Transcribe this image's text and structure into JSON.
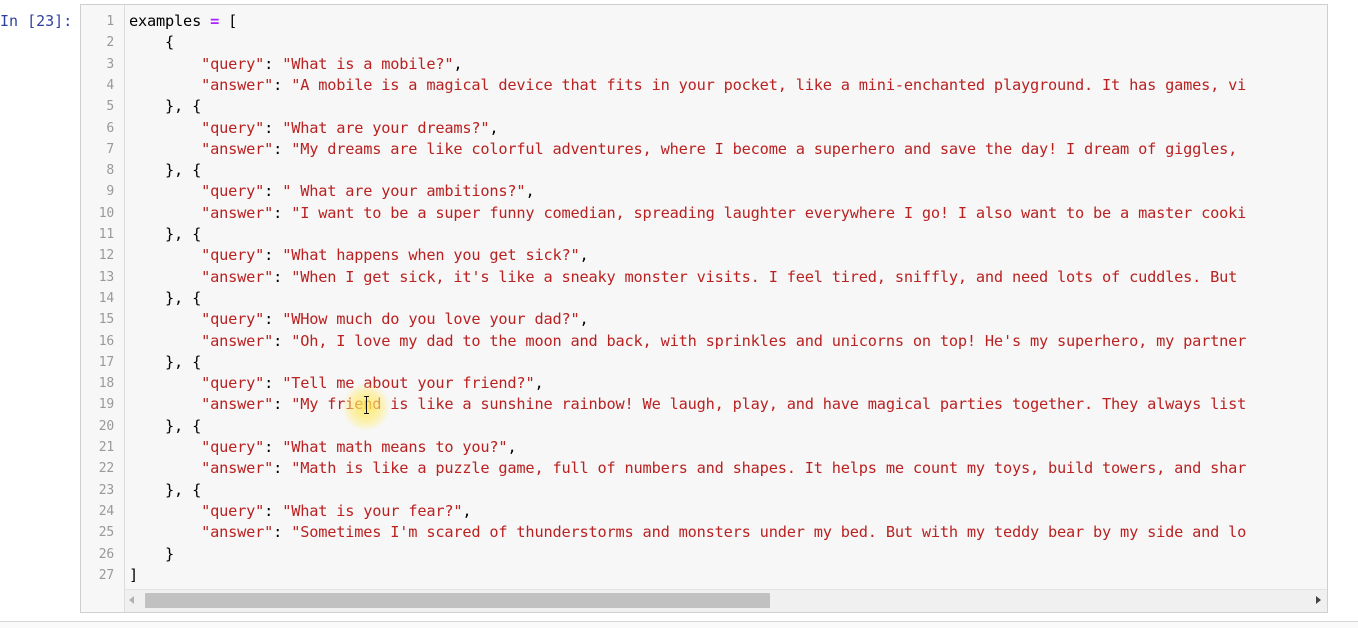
{
  "cell": {
    "prompt": "In [23]:",
    "lines": [
      {
        "num": "1",
        "tokens": [
          {
            "t": "var",
            "v": "examples "
          },
          {
            "t": "op",
            "v": "="
          },
          {
            "t": "punct",
            "v": " ["
          }
        ]
      },
      {
        "num": "2",
        "tokens": [
          {
            "t": "punct",
            "v": "    {"
          }
        ]
      },
      {
        "num": "3",
        "tokens": [
          {
            "t": "punct",
            "v": "        "
          },
          {
            "t": "key",
            "v": "\"query\""
          },
          {
            "t": "punct",
            "v": ": "
          },
          {
            "t": "val",
            "v": "\"What is a mobile?\""
          },
          {
            "t": "punct",
            "v": ","
          }
        ]
      },
      {
        "num": "4",
        "tokens": [
          {
            "t": "punct",
            "v": "        "
          },
          {
            "t": "key",
            "v": "\"answer\""
          },
          {
            "t": "punct",
            "v": ": "
          },
          {
            "t": "val",
            "v": "\"A mobile is a magical device that fits in your pocket, like a mini-enchanted playground. It has games, vi"
          }
        ]
      },
      {
        "num": "5",
        "tokens": [
          {
            "t": "punct",
            "v": "    }, {"
          }
        ]
      },
      {
        "num": "6",
        "tokens": [
          {
            "t": "punct",
            "v": "        "
          },
          {
            "t": "key",
            "v": "\"query\""
          },
          {
            "t": "punct",
            "v": ": "
          },
          {
            "t": "val",
            "v": "\"What are your dreams?\""
          },
          {
            "t": "punct",
            "v": ","
          }
        ]
      },
      {
        "num": "7",
        "tokens": [
          {
            "t": "punct",
            "v": "        "
          },
          {
            "t": "key",
            "v": "\"answer\""
          },
          {
            "t": "punct",
            "v": ": "
          },
          {
            "t": "val",
            "v": "\"My dreams are like colorful adventures, where I become a superhero and save the day! I dream of giggles, "
          }
        ]
      },
      {
        "num": "8",
        "tokens": [
          {
            "t": "punct",
            "v": "    }, {"
          }
        ]
      },
      {
        "num": "9",
        "tokens": [
          {
            "t": "punct",
            "v": "        "
          },
          {
            "t": "key",
            "v": "\"query\""
          },
          {
            "t": "punct",
            "v": ": "
          },
          {
            "t": "val",
            "v": "\" What are your ambitions?\""
          },
          {
            "t": "punct",
            "v": ","
          }
        ]
      },
      {
        "num": "10",
        "tokens": [
          {
            "t": "punct",
            "v": "        "
          },
          {
            "t": "key",
            "v": "\"answer\""
          },
          {
            "t": "punct",
            "v": ": "
          },
          {
            "t": "val",
            "v": "\"I want to be a super funny comedian, spreading laughter everywhere I go! I also want to be a master cooki"
          }
        ]
      },
      {
        "num": "11",
        "tokens": [
          {
            "t": "punct",
            "v": "    }, {"
          }
        ]
      },
      {
        "num": "12",
        "tokens": [
          {
            "t": "punct",
            "v": "        "
          },
          {
            "t": "key",
            "v": "\"query\""
          },
          {
            "t": "punct",
            "v": ": "
          },
          {
            "t": "val",
            "v": "\"What happens when you get sick?\""
          },
          {
            "t": "punct",
            "v": ","
          }
        ]
      },
      {
        "num": "13",
        "tokens": [
          {
            "t": "punct",
            "v": "        "
          },
          {
            "t": "key",
            "v": "\"answer\""
          },
          {
            "t": "punct",
            "v": ": "
          },
          {
            "t": "val",
            "v": "\"When I get sick, it's like a sneaky monster visits. I feel tired, sniffly, and need lots of cuddles. But "
          }
        ]
      },
      {
        "num": "14",
        "tokens": [
          {
            "t": "punct",
            "v": "    }, {"
          }
        ]
      },
      {
        "num": "15",
        "tokens": [
          {
            "t": "punct",
            "v": "        "
          },
          {
            "t": "key",
            "v": "\"query\""
          },
          {
            "t": "punct",
            "v": ": "
          },
          {
            "t": "val",
            "v": "\"WHow much do you love your dad?\""
          },
          {
            "t": "punct",
            "v": ","
          }
        ]
      },
      {
        "num": "16",
        "tokens": [
          {
            "t": "punct",
            "v": "        "
          },
          {
            "t": "key",
            "v": "\"answer\""
          },
          {
            "t": "punct",
            "v": ": "
          },
          {
            "t": "val",
            "v": "\"Oh, I love my dad to the moon and back, with sprinkles and unicorns on top! He's my superhero, my partner"
          }
        ]
      },
      {
        "num": "17",
        "tokens": [
          {
            "t": "punct",
            "v": "    }, {"
          }
        ]
      },
      {
        "num": "18",
        "tokens": [
          {
            "t": "punct",
            "v": "        "
          },
          {
            "t": "key",
            "v": "\"query\""
          },
          {
            "t": "punct",
            "v": ": "
          },
          {
            "t": "val",
            "v": "\"Tell me about your friend?\""
          },
          {
            "t": "punct",
            "v": ","
          }
        ]
      },
      {
        "num": "19",
        "tokens": [
          {
            "t": "punct",
            "v": "        "
          },
          {
            "t": "key",
            "v": "\"answer\""
          },
          {
            "t": "punct",
            "v": ": "
          },
          {
            "t": "val",
            "v": "\"My friend is like a sunshine rainbow! We laugh, play, and have magical parties together. They always list"
          }
        ]
      },
      {
        "num": "20",
        "tokens": [
          {
            "t": "punct",
            "v": "    }, {"
          }
        ]
      },
      {
        "num": "21",
        "tokens": [
          {
            "t": "punct",
            "v": "        "
          },
          {
            "t": "key",
            "v": "\"query\""
          },
          {
            "t": "punct",
            "v": ": "
          },
          {
            "t": "val",
            "v": "\"What math means to you?\""
          },
          {
            "t": "punct",
            "v": ","
          }
        ]
      },
      {
        "num": "22",
        "tokens": [
          {
            "t": "punct",
            "v": "        "
          },
          {
            "t": "key",
            "v": "\"answer\""
          },
          {
            "t": "punct",
            "v": ": "
          },
          {
            "t": "val",
            "v": "\"Math is like a puzzle game, full of numbers and shapes. It helps me count my toys, build towers, and shar"
          }
        ]
      },
      {
        "num": "23",
        "tokens": [
          {
            "t": "punct",
            "v": "    }, {"
          }
        ]
      },
      {
        "num": "24",
        "tokens": [
          {
            "t": "punct",
            "v": "        "
          },
          {
            "t": "key",
            "v": "\"query\""
          },
          {
            "t": "punct",
            "v": ": "
          },
          {
            "t": "val",
            "v": "\"What is your fear?\""
          },
          {
            "t": "punct",
            "v": ","
          }
        ]
      },
      {
        "num": "25",
        "tokens": [
          {
            "t": "punct",
            "v": "        "
          },
          {
            "t": "key",
            "v": "\"answer\""
          },
          {
            "t": "punct",
            "v": ": "
          },
          {
            "t": "val",
            "v": "\"Sometimes I'm scared of thunderstorms and monsters under my bed. But with my teddy bear by my side and lo"
          }
        ]
      },
      {
        "num": "26",
        "tokens": [
          {
            "t": "punct",
            "v": "    }"
          }
        ]
      },
      {
        "num": "27",
        "tokens": [
          {
            "t": "punct",
            "v": "]"
          }
        ]
      }
    ]
  },
  "scrollbar": {
    "left_arrow_icon": "triangle-left-icon",
    "right_arrow_icon": "triangle-right-icon",
    "thumb_fraction_start": 0.0,
    "thumb_fraction_visible": 0.53
  },
  "cursor": {
    "icon": "text-ibeam-icon",
    "highlight_color": "#ffe850"
  },
  "colors": {
    "string": "#ba2121",
    "operator": "#aa22ff",
    "prompt": "#303f9f",
    "line_number": "#999999",
    "cell_background": "#f7f7f7"
  }
}
